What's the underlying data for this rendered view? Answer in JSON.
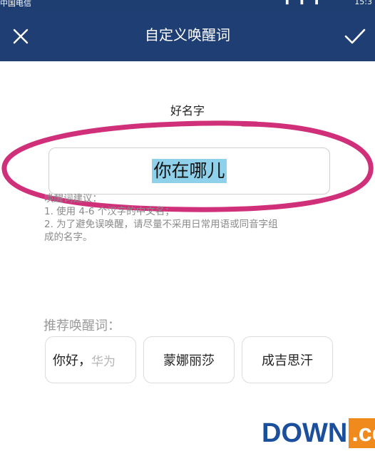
{
  "status_bar": {
    "carrier": "中国电信",
    "time": "15:3"
  },
  "header": {
    "title": "自定义唤醒词",
    "close_icon": "close-icon",
    "confirm_icon": "check-icon",
    "bg_color": "#1f3f74"
  },
  "name_section": {
    "label": "好名字",
    "input_value": "你在哪儿",
    "selection_color": "#8fd0ea",
    "annotation_color": "#d0307a"
  },
  "tips": {
    "heading": "唤醒词建议：",
    "lines": [
      "1. 使用 4-6 个汉字的中文名；",
      "2. 为了避免误唤醒，请尽量不采用日常用语或同音字组",
      "成的名字。"
    ]
  },
  "recommend": {
    "title": "推荐唤醒词：",
    "chips": [
      {
        "main": "你好，",
        "fade": "华为"
      },
      {
        "main": "蒙娜丽莎"
      },
      {
        "main": "成吉思汗"
      }
    ]
  },
  "watermark": {
    "main": "DOWN",
    "sub": ".cc"
  }
}
